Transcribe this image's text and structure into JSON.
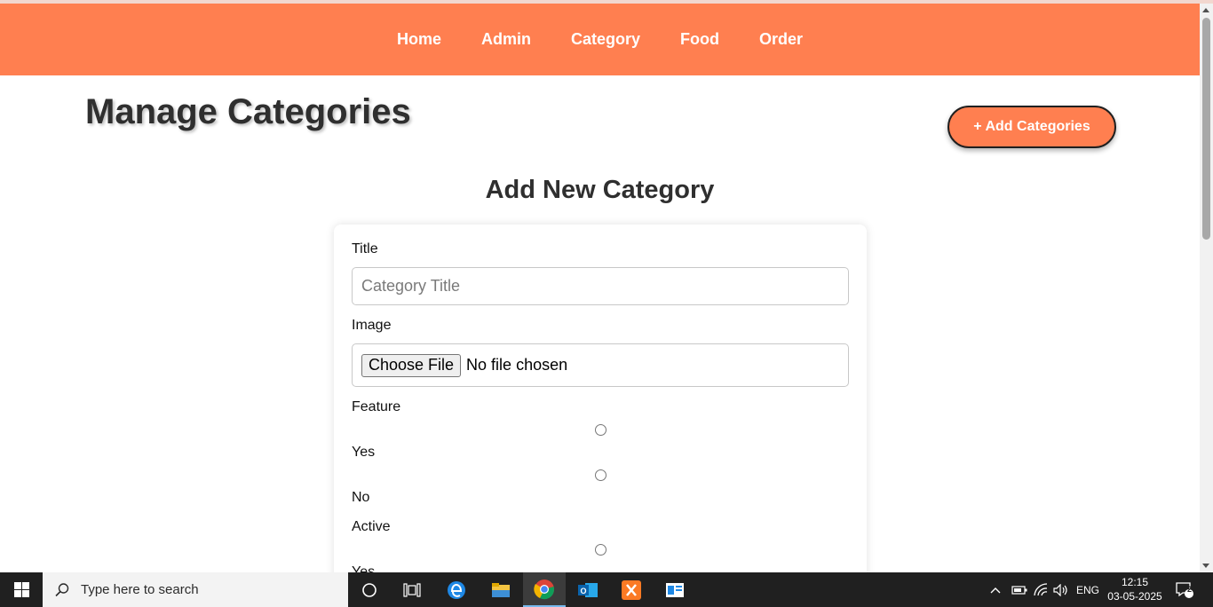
{
  "nav": {
    "items": [
      "Home",
      "Admin",
      "Category",
      "Food",
      "Order"
    ]
  },
  "page": {
    "title": "Manage Categories",
    "add_button": "+ Add Categories"
  },
  "form": {
    "heading": "Add New Category",
    "title_label": "Title",
    "title_placeholder": "Category Title",
    "image_label": "Image",
    "file_button": "Choose File",
    "file_status": "No file chosen",
    "feature_label": "Feature",
    "feature_yes": "Yes",
    "feature_no": "No",
    "active_label": "Active",
    "active_yes": "Yes"
  },
  "taskbar": {
    "search_placeholder": "Type here to search",
    "language": "ENG",
    "time": "12:15",
    "date": "03-05-2025",
    "notifications": "2"
  },
  "colors": {
    "accent": "#ff7f50",
    "taskbar": "#202020"
  }
}
